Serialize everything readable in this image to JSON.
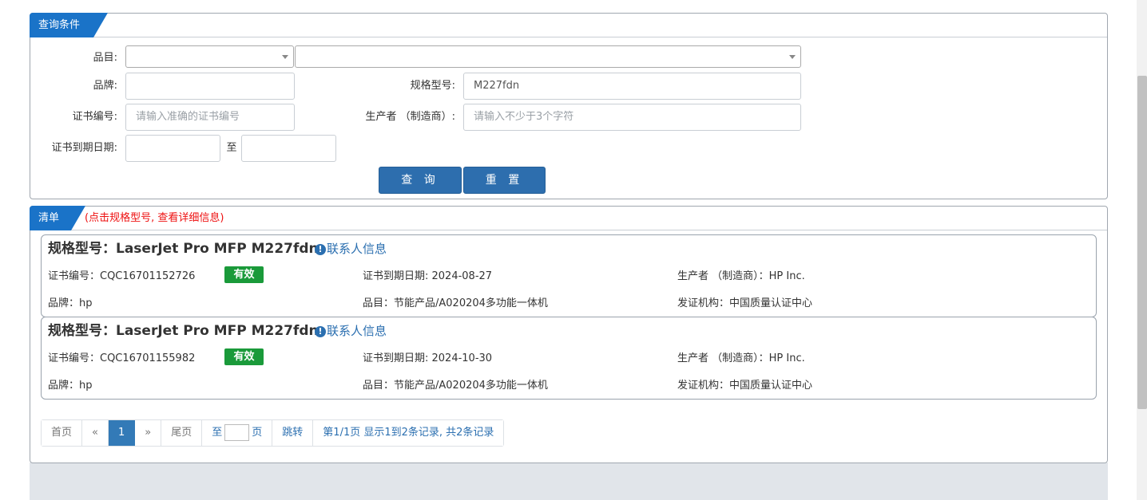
{
  "query": {
    "tab_title": "查询条件",
    "category_label": "品目:",
    "category_value": "",
    "subcategory_value": "",
    "brand_label": "品牌:",
    "brand_value": "",
    "model_label": "规格型号:",
    "model_value": "M227fdn",
    "cert_no_label": "证书编号:",
    "cert_no_placeholder": "请输入准确的证书编号",
    "producer_label": "生产者 （制造商）:",
    "producer_placeholder": "请输入不少于3个字符",
    "expiry_label": "证书到期日期:",
    "expiry_to": "至",
    "search_button": "查 询",
    "reset_button": "重 置"
  },
  "list": {
    "tab_title": "清单",
    "hint": "(点击规格型号, 查看详细信息)",
    "contact_label": "联系人信息",
    "items": [
      {
        "model": "规格型号：LaserJet Pro MFP M227fdn",
        "cert_no": "证书编号：CQC16701152726",
        "status": "有效",
        "expiry": "证书到期日期: 2024-08-27",
        "producer": "生产者 （制造商）：HP Inc.",
        "brand": "品牌：hp",
        "category": "品目：节能产品/A020204多功能一体机",
        "issuer": "发证机构：中国质量认证中心"
      },
      {
        "model": "规格型号：LaserJet Pro MFP M227fdn",
        "cert_no": "证书编号：CQC16701155982",
        "status": "有效",
        "expiry": "证书到期日期: 2024-10-30",
        "producer": "生产者 （制造商）：HP Inc.",
        "brand": "品牌：hp",
        "category": "品目：节能产品/A020204多功能一体机",
        "issuer": "发证机构：中国质量认证中心"
      }
    ]
  },
  "pager": {
    "first": "首页",
    "prev": "«",
    "current": "1",
    "next": "»",
    "last": "尾页",
    "goto_prefix": "至",
    "goto_suffix": "页",
    "jump": "跳转",
    "summary": "第1/1页  显示1到2条记录, 共2条记录"
  },
  "colors": {
    "tab_blue": "#1a73c8",
    "button_blue": "#2d6eae",
    "valid_green": "#1a9a3a",
    "hint_red": "#e11111",
    "link_blue": "#2b6fb0"
  }
}
